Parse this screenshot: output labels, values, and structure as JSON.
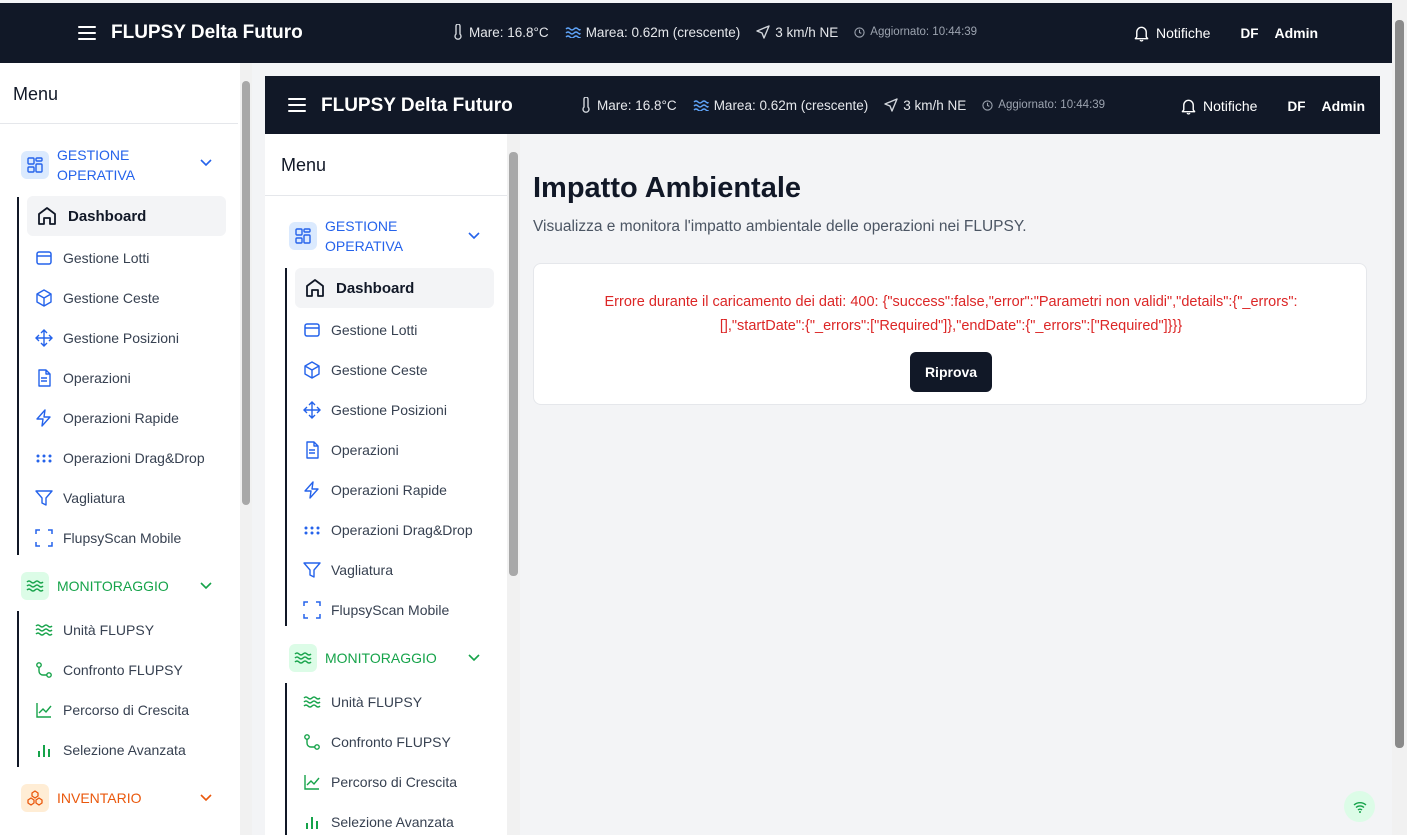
{
  "app": {
    "title": "FLUPSY Delta Futuro",
    "weather": {
      "sea": "Mare: 16.8°C",
      "tide": "Marea: 0.62m (crescente)",
      "wind": "3 km/h NE",
      "updated": "Aggiornato: 10:44:39"
    },
    "notifications_label": "Notifiche",
    "user_initials": "DF",
    "user_name": "Admin"
  },
  "sidebar": {
    "title": "Menu",
    "sections": [
      {
        "label": "GESTIONE OPERATIVA",
        "label_line1": "GESTIONE",
        "label_line2": "OPERATIVA",
        "color": "#2563eb",
        "icon": "layout-grid-icon",
        "items": [
          {
            "label": "Dashboard",
            "icon": "home-icon",
            "active": true
          },
          {
            "label": "Gestione Lotti",
            "icon": "package-icon"
          },
          {
            "label": "Gestione Ceste",
            "icon": "box-icon"
          },
          {
            "label": "Gestione Posizioni",
            "icon": "move-icon"
          },
          {
            "label": "Operazioni",
            "icon": "file-text-icon"
          },
          {
            "label": "Operazioni Rapide",
            "icon": "zap-icon"
          },
          {
            "label": "Operazioni Drag&Drop",
            "icon": "grip-icon"
          },
          {
            "label": "Vagliatura",
            "icon": "filter-icon"
          },
          {
            "label": "FlupsyScan Mobile",
            "icon": "scan-icon"
          }
        ]
      },
      {
        "label": "MONITORAGGIO",
        "color": "#16a34a",
        "icon": "waves-icon",
        "items": [
          {
            "label": "Unità FLUPSY",
            "icon": "waves-icon"
          },
          {
            "label": "Confronto FLUPSY",
            "icon": "git-compare-icon"
          },
          {
            "label": "Percorso di Crescita",
            "icon": "line-chart-icon"
          },
          {
            "label": "Selezione Avanzata",
            "icon": "bar-chart-icon"
          }
        ]
      },
      {
        "label": "INVENTARIO",
        "color": "#ea580c",
        "icon": "boxes-icon"
      }
    ]
  },
  "main": {
    "title": "Impatto Ambientale",
    "subtitle": "Visualizza e monitora l'impatto ambientale delle operazioni nei FLUPSY.",
    "error_line1": "Errore durante il caricamento dei dati: 400: {\"success\":false,\"error\":\"Parametri non validi\",\"details\":{\"_errors\":",
    "error_line2": "[],\"startDate\":{\"_errors\":[\"Required\"]},\"endDate\":{\"_errors\":[\"Required\"]}}}",
    "retry_label": "Riprova"
  },
  "colors": {
    "header_bg": "#111827",
    "blue": "#2563eb",
    "green": "#16a34a",
    "orange": "#ea580c",
    "error": "#dc2626"
  }
}
